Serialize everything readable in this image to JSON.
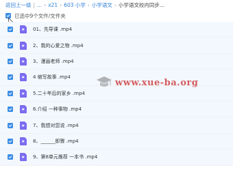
{
  "breadcrumb": {
    "back_label": "返回上一级",
    "items": [
      "...",
      "x21",
      "603 小学",
      "小学语文"
    ],
    "current": "小学语文校内同步..."
  },
  "selection": {
    "summary": "已选中9个文件/文件夹"
  },
  "files": [
    {
      "name": "01、先导课 .mp4",
      "selected": true,
      "icon": "video-file-icon"
    },
    {
      "name": "2、我的心爱之物 .mp4",
      "selected": true,
      "icon": "video-file-icon"
    },
    {
      "name": "3、漫画老师 .mp4",
      "selected": true,
      "icon": "video-file-icon"
    },
    {
      "name": "4 缩写故事 .mp4",
      "selected": true,
      "icon": "video-file-icon"
    },
    {
      "name": "5.二十年后的家乡 .mp4",
      "selected": true,
      "icon": "video-file-icon"
    },
    {
      "name": "6.介绍 一种事物 .mp4",
      "selected": true,
      "icon": "video-file-icon"
    },
    {
      "name": "7、我想对您说 .mp4",
      "selected": true,
      "icon": "video-file-icon"
    },
    {
      "name": "8、______即骤 .mp4",
      "selected": true,
      "icon": "video-file-icon"
    },
    {
      "name": "9、第8单元推荐 一本书 .mp4",
      "selected": true,
      "icon": "video-file-icon"
    }
  ],
  "watermark": {
    "text": "www.xue-ba.org"
  },
  "colors": {
    "accent": "#3c8ee6",
    "video_icon": "#7b6cf0",
    "link": "#2f7fd8",
    "watermark": "#c82828"
  }
}
